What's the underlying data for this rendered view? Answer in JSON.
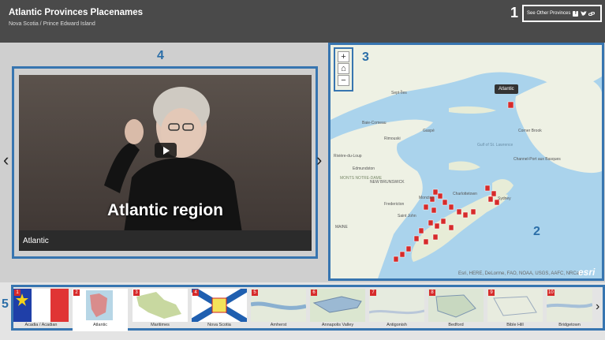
{
  "header": {
    "title": "Atlantic Provinces Placenames",
    "subtitle": "Nova Scotia / Prince Edward Island",
    "share_text": "See Other Provinces",
    "share_icons": [
      "facebook-icon",
      "twitter-icon",
      "link-icon"
    ]
  },
  "callouts": {
    "n1": "1",
    "n2": "2",
    "n3": "3",
    "n4": "4",
    "n5": "5"
  },
  "video": {
    "caption": "Atlantic region",
    "label": "Atlantic"
  },
  "map": {
    "tooltip": "Atlantic",
    "attribution": "Esri, HERE, DeLorme, FAO, NOAA, USGS, AAFC, NRCan",
    "logo": "esri",
    "labels": [
      "Sept-Îles",
      "Baie-Comeau",
      "Rimouski",
      "Gaspé",
      "Rivière-du-Loup",
      "Edmundston",
      "Fredericton",
      "Moncton",
      "Charlottetown",
      "Saint John",
      "Sydney",
      "Corner Brook",
      "Channel-Port aux Basques",
      "MAINE",
      "NEW BRUNSWICK",
      "Gulf of St. Lawrence",
      "MONTS NOTRE-DAME"
    ],
    "zoom_in": "+",
    "home": "⌂",
    "zoom_out": "−",
    "accent": "#d62b2b"
  },
  "thumbnails": [
    {
      "num": "1",
      "label": "Acadia / Acadian"
    },
    {
      "num": "2",
      "label": "Atlantic"
    },
    {
      "num": "3",
      "label": "Maritimes"
    },
    {
      "num": "4",
      "label": "Nova Scotia"
    },
    {
      "num": "5",
      "label": "Amherst"
    },
    {
      "num": "6",
      "label": "Annapolis Valley"
    },
    {
      "num": "7",
      "label": "Antigonish"
    },
    {
      "num": "8",
      "label": "Bedford"
    },
    {
      "num": "9",
      "label": "Bible Hill"
    },
    {
      "num": "10",
      "label": "Bridgetown"
    }
  ],
  "colors": {
    "frame": "#3775b0",
    "header_bg": "#4a4a4a",
    "marker": "#d62b2b"
  }
}
